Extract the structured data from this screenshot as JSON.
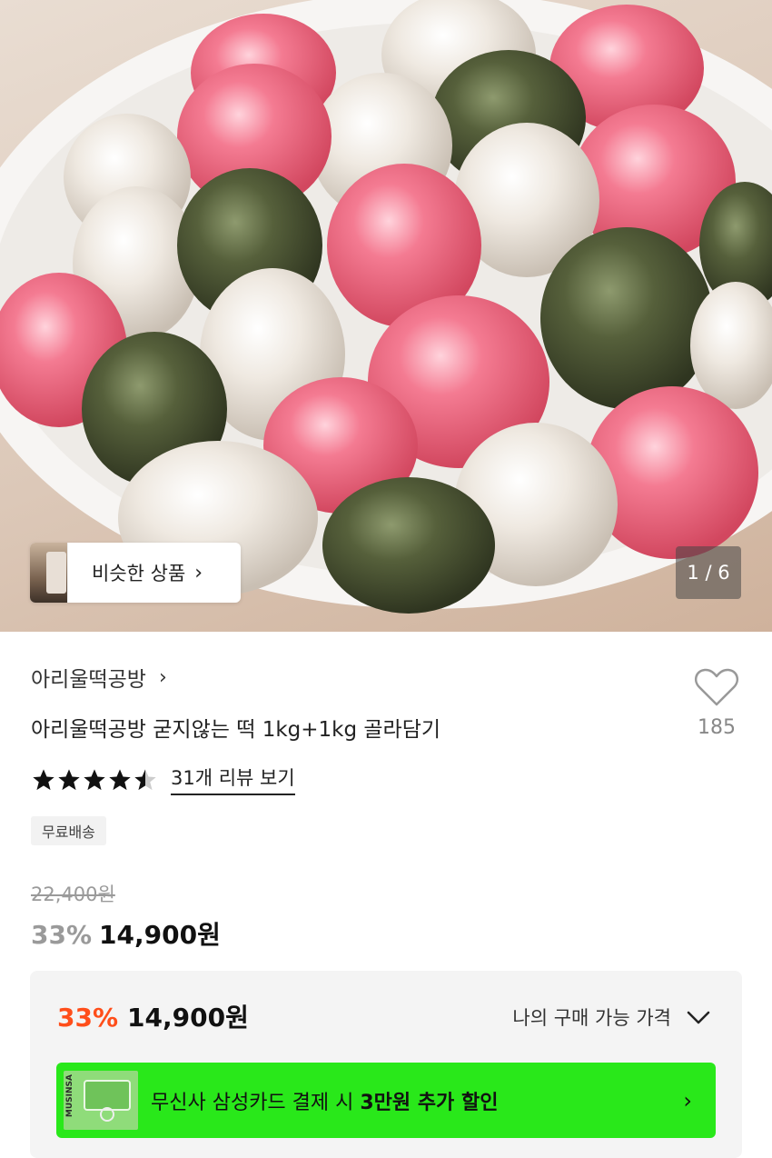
{
  "hero": {
    "image_description_icon": "rice-cake-photo",
    "similar_products_label": "비슷한 상품",
    "page_indicator": "1 / 6"
  },
  "product": {
    "brand": "아리울떡공방",
    "title": "아리울떡공방 굳지않는 떡 1kg+1kg 골라담기",
    "like_count": "185",
    "rating": 4.5,
    "review_link": "31개 리뷰 보기",
    "badge": "무료배송",
    "original_price": "22,400원",
    "discount": "33%",
    "price": "14,900원"
  },
  "benefit": {
    "discount": "33%",
    "price": "14,900원",
    "my_price_label": "나의 구매 가능 가격",
    "card_thumb_text": "MUSINSA",
    "card_text_prefix": "무신사 삼성카드 결제 시 ",
    "card_text_bold": "3만원 추가 할인"
  },
  "colors": {
    "discount_orange": "#ff4e1a",
    "banner_green": "#29e81a"
  }
}
